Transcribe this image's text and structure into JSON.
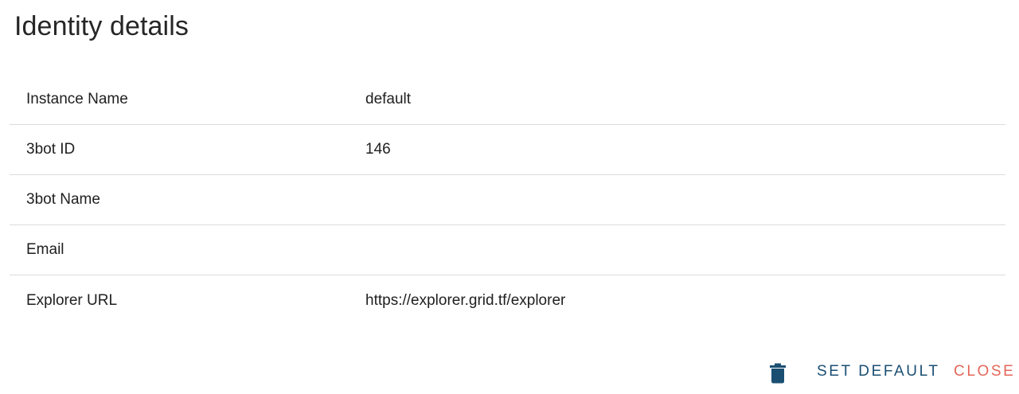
{
  "dialog": {
    "title": "Identity details"
  },
  "details": [
    {
      "label": "Instance Name",
      "value": "default"
    },
    {
      "label": "3bot ID",
      "value": "146"
    },
    {
      "label": "3bot Name",
      "value": ""
    },
    {
      "label": "Email",
      "value": ""
    },
    {
      "label": "Explorer URL",
      "value": "https://explorer.grid.tf/explorer"
    }
  ],
  "actions": {
    "delete_icon": "trash-icon",
    "set_default_label": "SET DEFAULT",
    "close_label": "CLOSE"
  },
  "colors": {
    "primary": "#1b4f72",
    "danger": "#e4675a",
    "divider": "#dcdcdc"
  }
}
